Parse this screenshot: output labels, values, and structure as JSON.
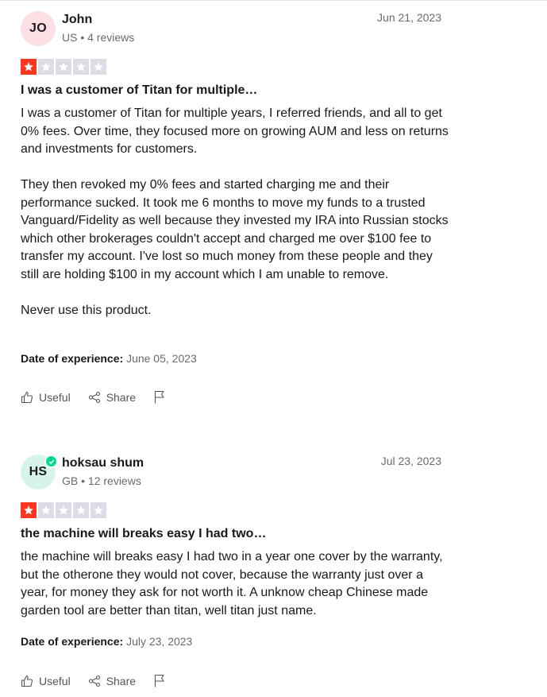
{
  "reviews": [
    {
      "initials": "JO",
      "name": "John",
      "meta": "US • 4 reviews",
      "date": "Jun 21, 2023",
      "rating": 1,
      "title": "I was a customer of Titan for multiple…",
      "paragraphs": [
        "I was a customer of Titan for multiple years, I referred friends, and all to get 0% fees. Over time, they focused more on growing AUM and less on returns and investments for customers.",
        "They then revoked my 0% fees and started charging me and their performance sucked. It took me 6 months to move my funds to a trusted Vanguard/Fidelity as well because they invested my IRA into Russian stocks which other brokerages couldn't accept and charged me over $100 fee to transfer my account. I've lost so much money from these people and they still are holding $100 in my account which I am unable to remove.",
        "Never use this product."
      ],
      "experience_label": "Date of experience:",
      "experience_date": "June 05, 2023"
    },
    {
      "initials": "HS",
      "name": "hoksau shum",
      "meta": "GB • 12 reviews",
      "date": "Jul 23, 2023",
      "rating": 1,
      "verified": true,
      "title": "the machine will breaks easy I had two…",
      "paragraphs": [
        "the machine will breaks easy I had two in a year one cover by the warranty, but the otherone they would not cover, because the warranty just over a year, for money they ask for not worth it. A unknow cheap Chinese made garden tool are better than titan, well titan just name."
      ],
      "experience_label": "Date of experience:",
      "experience_date": "July 23, 2023"
    }
  ],
  "actions": {
    "useful_label": "Useful",
    "share_label": "Share"
  },
  "colors": {
    "star_active": "#ff3722",
    "star_inactive": "#dcdce6",
    "verified": "#04da8d"
  },
  "icons": [
    "thumbs-up-icon",
    "share-icon",
    "flag-icon",
    "star-icon",
    "verified-check-icon"
  ]
}
